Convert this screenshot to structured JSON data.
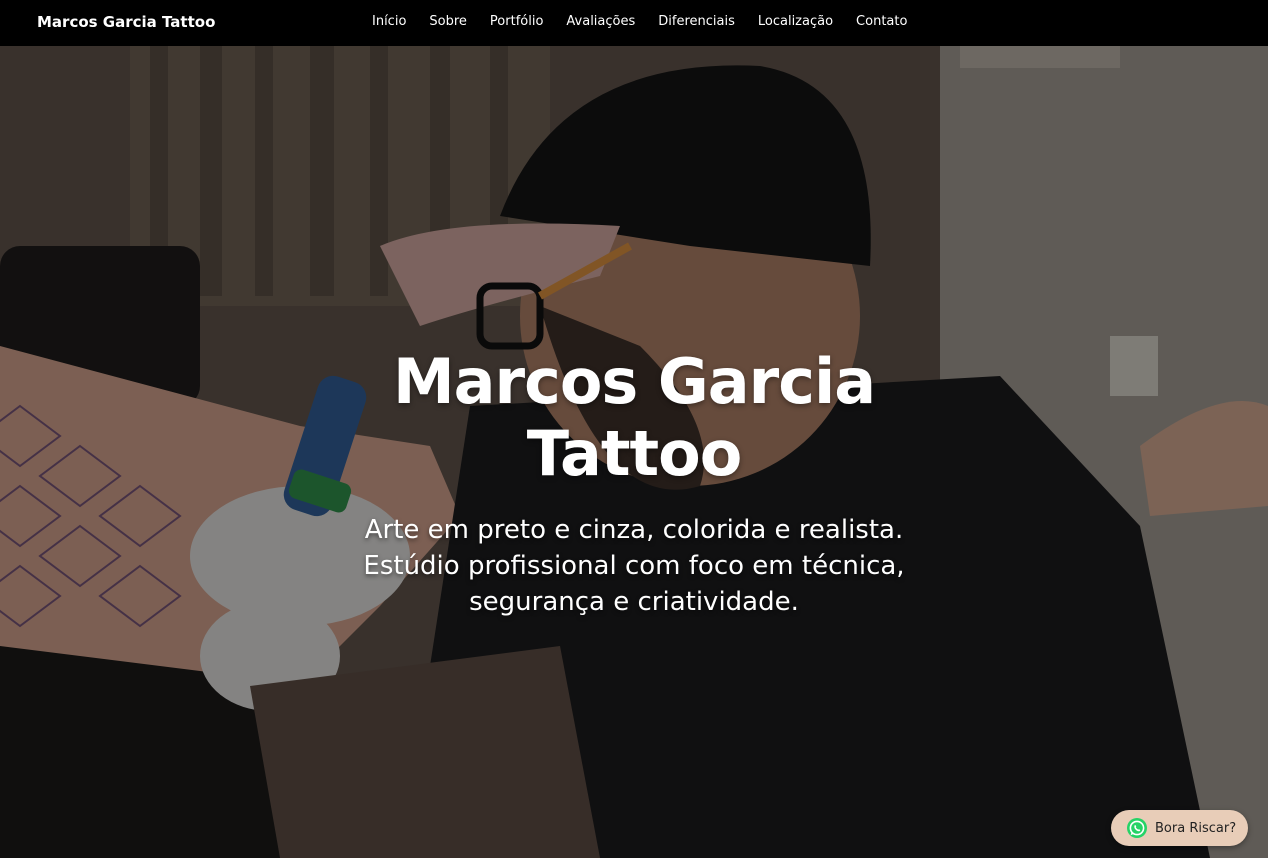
{
  "navbar": {
    "brand": "Marcos Garcia Tattoo",
    "links": [
      {
        "label": "Início"
      },
      {
        "label": "Sobre"
      },
      {
        "label": "Portfólio"
      },
      {
        "label": "Avaliações"
      },
      {
        "label": "Diferenciais"
      },
      {
        "label": "Localização"
      },
      {
        "label": "Contato"
      }
    ]
  },
  "hero": {
    "title": "Marcos Garcia Tattoo",
    "subtitle": "Arte em preto e cinza, colorida e realista. Estúdio profissional com foco em técnica, segurança e criatividade.",
    "background_image": "tattoo-artist-working-photo"
  },
  "whatsapp": {
    "label": "Bora Riscar?",
    "icon": "whatsapp-icon",
    "color": "#25D366",
    "button_color": "#e8cdb8"
  },
  "colors": {
    "navbar_bg": "#000000",
    "text": "#ffffff"
  }
}
